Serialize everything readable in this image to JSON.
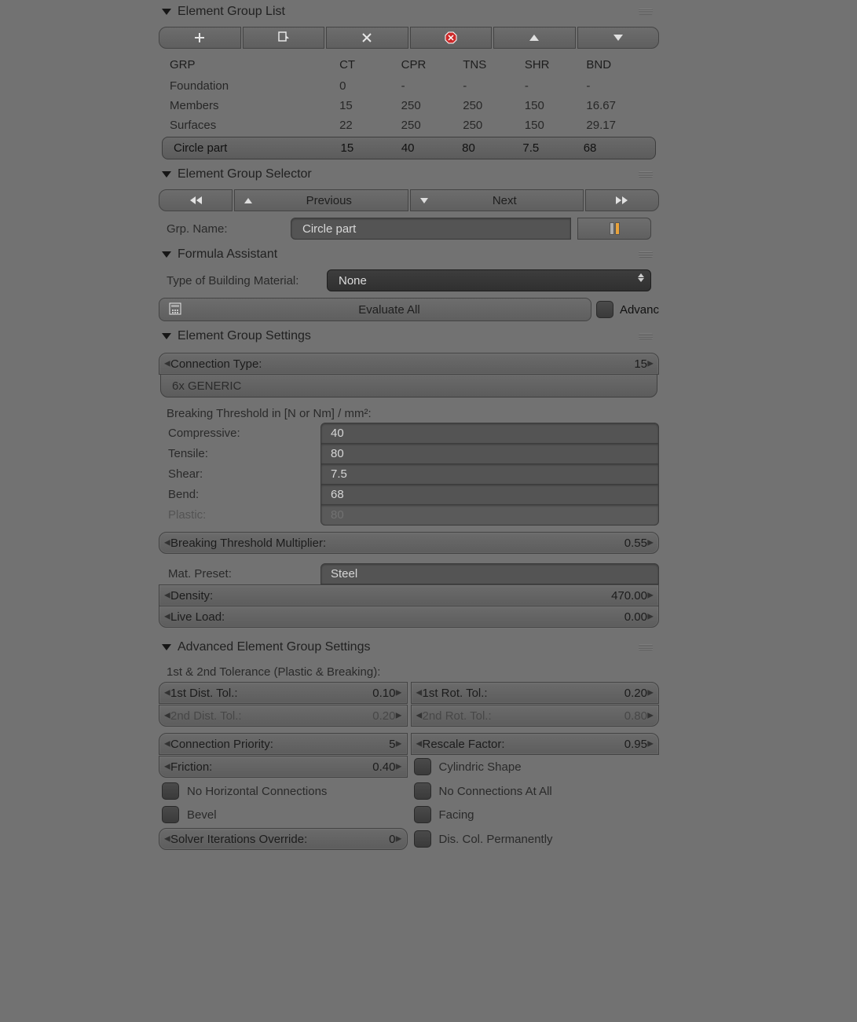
{
  "sections": {
    "group_list": "Element Group List",
    "group_selector": "Element Group Selector",
    "formula": "Formula Assistant",
    "group_settings": "Element Group Settings",
    "advanced": "Advanced Element Group Settings"
  },
  "table": {
    "headers": {
      "grp": "GRP",
      "ct": "CT",
      "cpr": "CPR",
      "tns": "TNS",
      "shr": "SHR",
      "bnd": "BND"
    },
    "rows": [
      {
        "grp": "Foundation",
        "ct": "0",
        "cpr": "-",
        "tns": "-",
        "shr": "-",
        "bnd": "-"
      },
      {
        "grp": "Members",
        "ct": "15",
        "cpr": "250",
        "tns": "250",
        "shr": "150",
        "bnd": "16.67"
      },
      {
        "grp": "Surfaces",
        "ct": "22",
        "cpr": "250",
        "tns": "250",
        "shr": "150",
        "bnd": "29.17"
      }
    ],
    "active": {
      "grp": "Circle part",
      "ct": "15",
      "cpr": "40",
      "tns": "80",
      "shr": "7.5",
      "bnd": "68"
    }
  },
  "selector": {
    "prev": "Previous",
    "next": "Next",
    "grp_name_label": "Grp. Name:",
    "grp_name_value": "Circle part"
  },
  "formula": {
    "type_label": "Type of Building Material:",
    "type_value": "None",
    "evaluate": "Evaluate All",
    "advanced": "Advanc"
  },
  "settings": {
    "conn_type_label": "Connection Type:",
    "conn_type_value": "15",
    "conn_type_name": "6x GENERIC",
    "threshold_header": "Breaking Threshold in [N or Nm] / mm²:",
    "thresholds": {
      "compressive_label": "Compressive:",
      "compressive_value": "40",
      "tensile_label": "Tensile:",
      "tensile_value": "80",
      "shear_label": "Shear:",
      "shear_value": "7.5",
      "bend_label": "Bend:",
      "bend_value": "68",
      "plastic_label": "Plastic:",
      "plastic_value": "80"
    },
    "multiplier_label": "Breaking Threshold Multiplier:",
    "multiplier_value": "0.55",
    "mat_preset_label": "Mat. Preset:",
    "mat_preset_value": "Steel",
    "density_label": "Density:",
    "density_value": "470.00",
    "live_load_label": "Live Load:",
    "live_load_value": "0.00"
  },
  "advanced": {
    "tol_header": "1st & 2nd Tolerance (Plastic & Breaking):",
    "dist1_label": "1st Dist. Tol.:",
    "dist1_value": "0.10",
    "dist2_label": "2nd Dist. Tol.:",
    "dist2_value": "0.20",
    "rot1_label": "1st Rot. Tol.:",
    "rot1_value": "0.20",
    "rot2_label": "2nd Rot. Tol.:",
    "rot2_value": "0.80",
    "conn_prio_label": "Connection Priority:",
    "conn_prio_value": "5",
    "rescale_label": "Rescale Factor:",
    "rescale_value": "0.95",
    "friction_label": "Friction:",
    "friction_value": "0.40",
    "cyl_shape": "Cylindric Shape",
    "no_horiz": "No Horizontal Connections",
    "no_conn": "No Connections At All",
    "bevel": "Bevel",
    "facing": "Facing",
    "solver_label": "Solver Iterations Override:",
    "solver_value": "0",
    "dis_col": "Dis. Col. Permanently"
  }
}
